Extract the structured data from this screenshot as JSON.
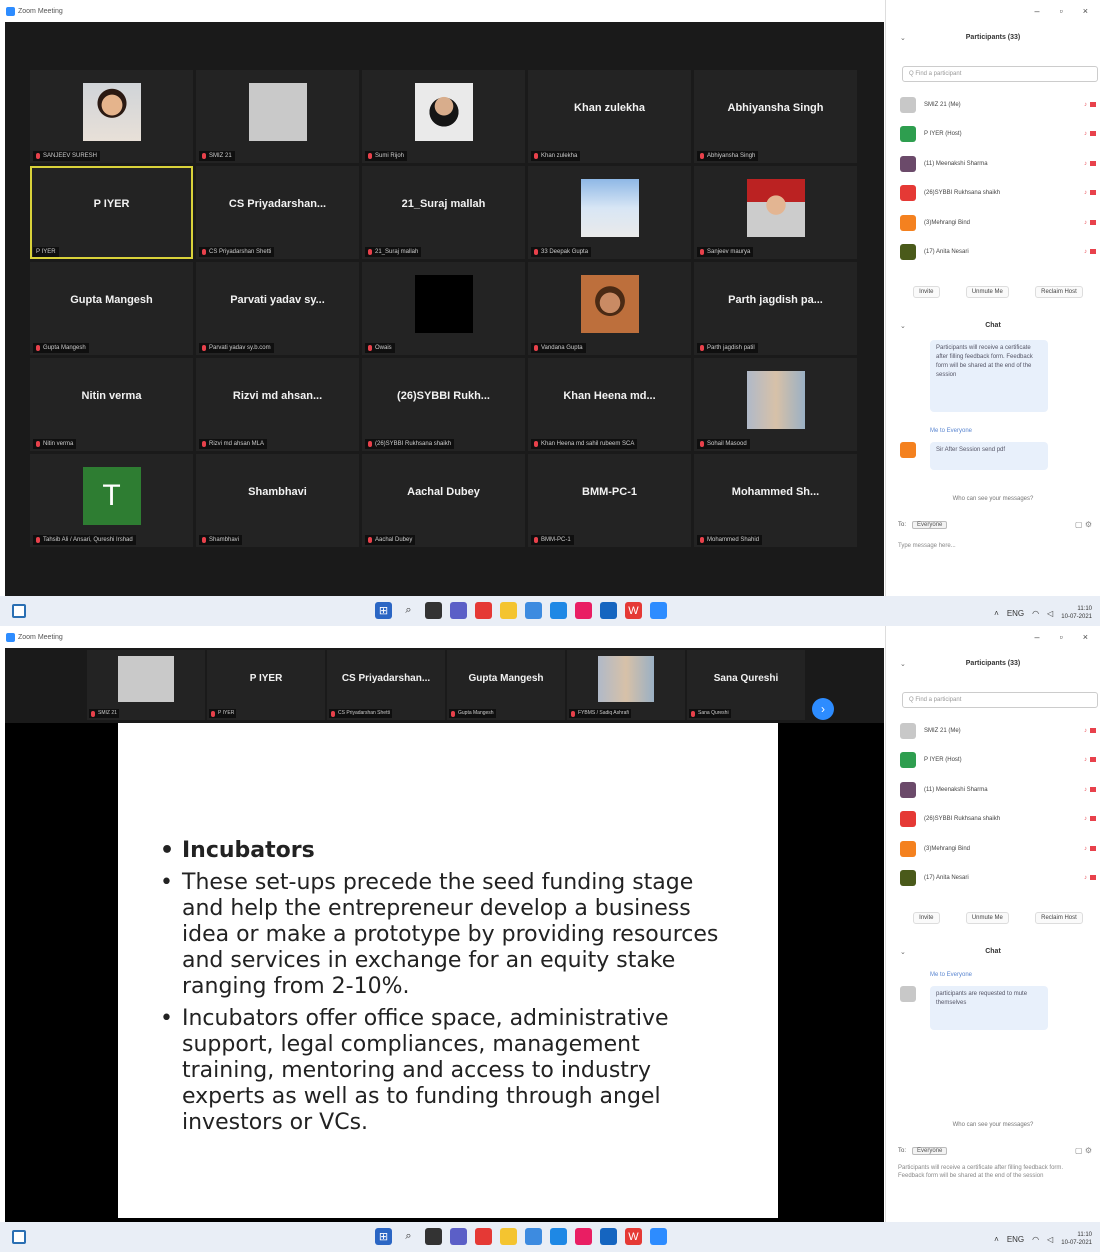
{
  "window_title": "Zoom Meeting",
  "top": {
    "gallery": [
      {
        "name": "",
        "label": "SANJEEV SURESH",
        "photo": "face1",
        "active": false
      },
      {
        "name": "",
        "label": "SMIZ 21",
        "photo": "gray",
        "active": false
      },
      {
        "name": "",
        "label": "Sumi Rijoh",
        "photo": "face2",
        "active": false
      },
      {
        "name": "Khan zulekha",
        "label": "Khan zulekha",
        "photo": "",
        "active": false
      },
      {
        "name": "Abhiyansha Singh",
        "label": "Abhiyansha Singh",
        "photo": "",
        "active": false
      },
      {
        "name": "P IYER",
        "label": "P IYER",
        "photo": "",
        "active": true
      },
      {
        "name": "CS Priyadarshan...",
        "label": "CS Priyadarshan Shetti",
        "photo": "",
        "active": false
      },
      {
        "name": "21_Suraj mallah",
        "label": "21_Suraj mallah",
        "photo": "",
        "active": false
      },
      {
        "name": "",
        "label": "33 Deepak Gupta",
        "photo": "cloud",
        "active": false
      },
      {
        "name": "",
        "label": "Sanjeev maurya",
        "photo": "red",
        "active": false
      },
      {
        "name": "Gupta Mangesh",
        "label": "Gupta Mangesh",
        "photo": "",
        "active": false
      },
      {
        "name": "Parvati yadav sy...",
        "label": "Parvati yadav sy.b.com",
        "photo": "",
        "active": false
      },
      {
        "name": "",
        "label": "Owais",
        "photo": "black",
        "active": false
      },
      {
        "name": "",
        "label": "Vandana Gupta",
        "photo": "face3",
        "active": false
      },
      {
        "name": "Parth jagdish pa...",
        "label": "Parth jagdish patil",
        "photo": "",
        "active": false
      },
      {
        "name": "Nitin verma",
        "label": "Nitin verma",
        "photo": "",
        "active": false
      },
      {
        "name": "Rizvi md ahsan...",
        "label": "Rizvi md ahsan MLA",
        "photo": "",
        "active": false
      },
      {
        "name": "(26)SYBBI Rukh...",
        "label": "(26)SYBBI Rukhsana shaikh",
        "photo": "",
        "active": false
      },
      {
        "name": "Khan Heena md...",
        "label": "Khan Heena md sahil rubeem SCA",
        "photo": "",
        "active": false
      },
      {
        "name": "",
        "label": "Sohail Masood",
        "photo": "group",
        "active": false
      },
      {
        "name": "",
        "label": "Tahsib Ali / Ansari, Qureshi Irshad",
        "photo": "tavatar",
        "avatar_letter": "T",
        "active": false
      },
      {
        "name": "Shambhavi",
        "label": "Shambhavi",
        "photo": "",
        "active": false
      },
      {
        "name": "Aachal Dubey",
        "label": "Aachal Dubey",
        "photo": "",
        "active": false
      },
      {
        "name": "BMM-PC-1",
        "label": "BMM-PC-1",
        "photo": "",
        "active": false
      },
      {
        "name": "Mohammed Sh...",
        "label": "Mohammed Shahid",
        "photo": "",
        "active": false
      }
    ],
    "participants_title": "Participants (33)",
    "search_placeholder": "Q Find a participant",
    "participants": [
      {
        "name": "SMIZ 21 (Me)",
        "color": "#c8c8c8"
      },
      {
        "name": "P IYER (Host)",
        "color": "#2e9e4f"
      },
      {
        "name": "(11) Meenakshi Sharma",
        "color": "#6b4a6a"
      },
      {
        "name": "(26)SYBBI Rukhsana shaikh",
        "color": "#e53935"
      },
      {
        "name": "(3)Mehrangi Bind",
        "color": "#f4811f"
      },
      {
        "name": "(17) Anita Nesari",
        "color": "#4a5a1a"
      }
    ],
    "buttons": [
      "Invite",
      "Unmute Me",
      "Reclaim Host"
    ],
    "chat_title": "Chat",
    "chat_msg1": "Participants will receive a certificate after filling feedback form. Feedback form will be shared at the end of the session",
    "chat_sender2": "Me to Everyone",
    "chat_msg2": "Sir After Session send pdf",
    "who_can_see": "Who can see your messages?",
    "to_label": "To:",
    "to_value": "Everyone",
    "type_hint": "Type message here..."
  },
  "bottom": {
    "strip": [
      {
        "name": "",
        "label": "SMIZ 21",
        "photo": "gray"
      },
      {
        "name": "P IYER",
        "label": "P IYER",
        "photo": ""
      },
      {
        "name": "CS Priyadarshan...",
        "label": "CS Priyadarshan Shetti",
        "photo": ""
      },
      {
        "name": "Gupta Mangesh",
        "label": "Gupta Mangesh",
        "photo": ""
      },
      {
        "name": "",
        "label": "FYBMS / Sadiq Ashrafi",
        "photo": "group"
      },
      {
        "name": "Sana Qureshi",
        "label": "Sana Qureshi",
        "photo": ""
      }
    ],
    "slide": {
      "bullet1": "Incubators",
      "bullet2": "These set-ups precede the seed funding stage and help the entrepreneur develop a business idea or make a prototype by providing resources and services in exchange for an equity stake ranging from 2-10%.",
      "bullet3": "Incubators offer office space, administrative support, legal compliances, management training, mentoring and access to industry experts as well as to funding through angel investors or VCs."
    },
    "participants_title": "Participants (33)",
    "search_placeholder": "Q Find a participant",
    "participants": [
      {
        "name": "SMIZ 21 (Me)",
        "color": "#c8c8c8"
      },
      {
        "name": "P IYER (Host)",
        "color": "#2e9e4f"
      },
      {
        "name": "(11) Meenakshi Sharma",
        "color": "#6b4a6a"
      },
      {
        "name": "(26)SYBBI Rukhsana shaikh",
        "color": "#e53935"
      },
      {
        "name": "(3)Mehrangi Bind",
        "color": "#f4811f"
      },
      {
        "name": "(17) Anita Nesari",
        "color": "#4a5a1a"
      }
    ],
    "buttons": [
      "Invite",
      "Unmute Me",
      "Reclaim Host"
    ],
    "chat_title": "Chat",
    "chat_sender1": "Me to Everyone",
    "chat_msg1": "participants are requested to mute themselves",
    "who_can_see": "Who can see your messages?",
    "to_label": "To:",
    "to_value": "Everyone",
    "type_hint": "Participants will receive a certificate after filling feedback form. Feedback form will be shared at the end of the session"
  },
  "taskbar": {
    "time": "11:10",
    "date": "10-07-2021",
    "lang": "ENG"
  }
}
